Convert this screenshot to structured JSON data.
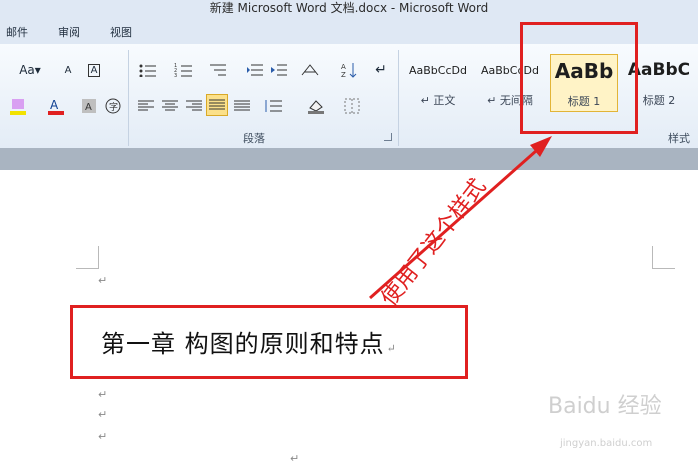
{
  "window": {
    "title": "新建 Microsoft Word 文档.docx - Microsoft Word"
  },
  "ribbon_tabs": [
    "邮件",
    "审阅",
    "视图"
  ],
  "groups": {
    "paragraph": {
      "label": "段落"
    },
    "styles": {
      "label": "样式",
      "cards": [
        {
          "sample": "AaBbCcDd",
          "name": "↵ 正文",
          "selected": false
        },
        {
          "sample": "AaBbCcDd",
          "name": "↵ 无间隔",
          "selected": false
        },
        {
          "sample": "AaBb",
          "name": "标题 1",
          "selected": true
        },
        {
          "sample": "AaBbC",
          "name": "标题 2",
          "selected": false
        }
      ]
    }
  },
  "document": {
    "heading_text": "第一章  构图的原则和特点",
    "paragraph_mark": "↵"
  },
  "annotation": {
    "text": "使用了这个样式"
  },
  "watermark": {
    "main": "Baidu 经验",
    "sub": "jingyan.baidu.com"
  },
  "colors": {
    "highlight_red": "#e02020",
    "selected_style_fill": "#fff3c6",
    "active_button_fill": "#fbe08a"
  },
  "font_controls": {
    "size_button": "Aa▾",
    "clear_format": "A",
    "char_border": "A"
  }
}
